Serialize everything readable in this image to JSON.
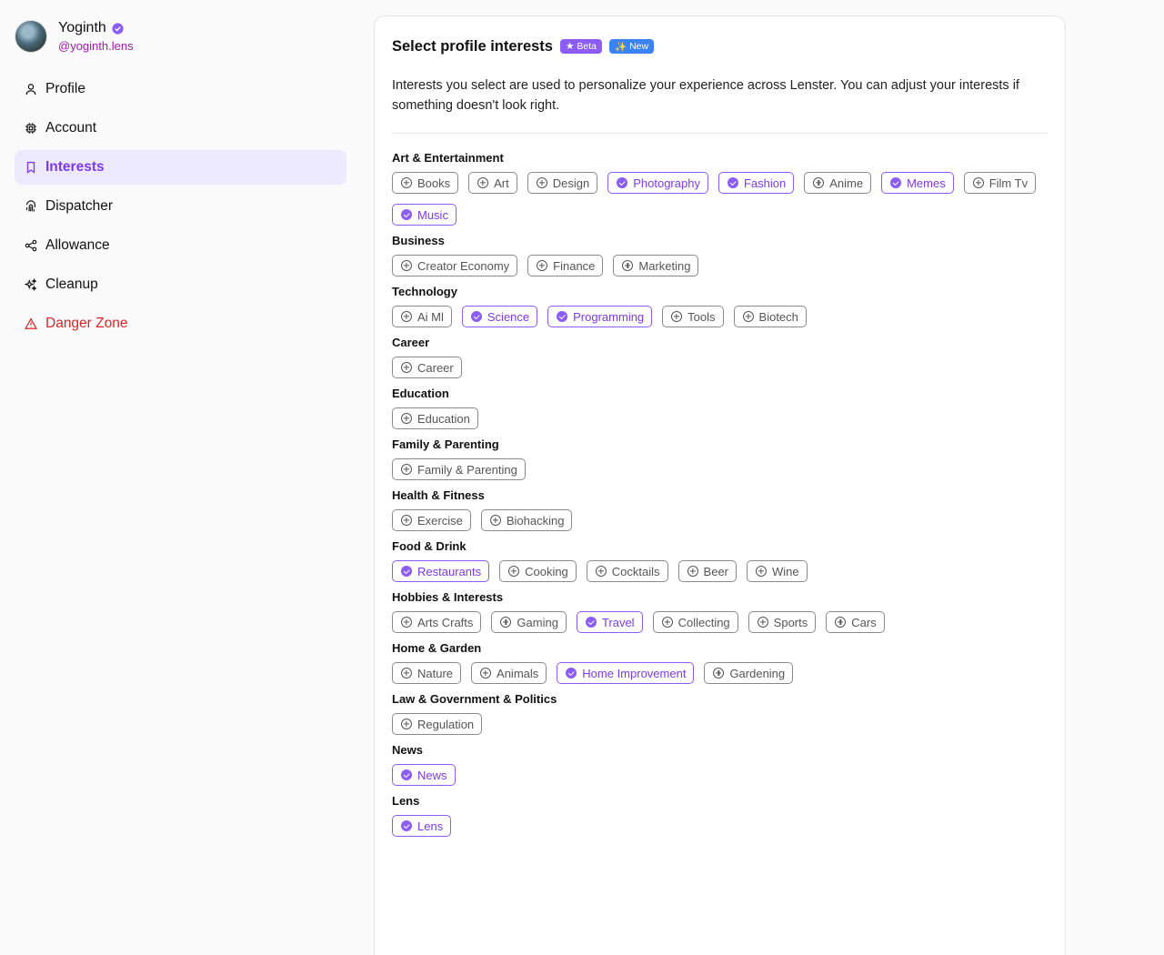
{
  "user": {
    "name": "Yoginth",
    "handle": "@yoginth.lens"
  },
  "nav": [
    {
      "label": "Profile",
      "icon": "user-icon"
    },
    {
      "label": "Account",
      "icon": "chip-icon"
    },
    {
      "label": "Interests",
      "icon": "bookmark-icon",
      "active": true
    },
    {
      "label": "Dispatcher",
      "icon": "fingerprint-icon"
    },
    {
      "label": "Allowance",
      "icon": "share-icon"
    },
    {
      "label": "Cleanup",
      "icon": "sparkles-icon"
    },
    {
      "label": "Danger Zone",
      "icon": "warning-icon",
      "danger": true
    }
  ],
  "card": {
    "title": "Select profile interests",
    "badges": [
      "Beta",
      "New"
    ],
    "description": "Interests you select are used to personalize your experience across Lenster. You can adjust your interests if something doesn't look right."
  },
  "groups": [
    {
      "title": "Art & Entertainment",
      "items": [
        {
          "label": "Books",
          "selected": false
        },
        {
          "label": "Art",
          "selected": false
        },
        {
          "label": "Design",
          "selected": false
        },
        {
          "label": "Photography",
          "selected": true
        },
        {
          "label": "Fashion",
          "selected": true
        },
        {
          "label": "Anime",
          "selected": false
        },
        {
          "label": "Memes",
          "selected": true
        },
        {
          "label": "Film Tv",
          "selected": false
        },
        {
          "label": "Music",
          "selected": true
        }
      ]
    },
    {
      "title": "Business",
      "items": [
        {
          "label": "Creator Economy",
          "selected": false
        },
        {
          "label": "Finance",
          "selected": false
        },
        {
          "label": "Marketing",
          "selected": false
        }
      ]
    },
    {
      "title": "Technology",
      "items": [
        {
          "label": "Ai Ml",
          "selected": false
        },
        {
          "label": "Science",
          "selected": true
        },
        {
          "label": "Programming",
          "selected": true
        },
        {
          "label": "Tools",
          "selected": false
        },
        {
          "label": "Biotech",
          "selected": false
        }
      ]
    },
    {
      "title": "Career",
      "items": [
        {
          "label": "Career",
          "selected": false
        }
      ]
    },
    {
      "title": "Education",
      "items": [
        {
          "label": "Education",
          "selected": false
        }
      ]
    },
    {
      "title": "Family & Parenting",
      "items": [
        {
          "label": "Family & Parenting",
          "selected": false
        }
      ]
    },
    {
      "title": "Health & Fitness",
      "items": [
        {
          "label": "Exercise",
          "selected": false
        },
        {
          "label": "Biohacking",
          "selected": false
        }
      ]
    },
    {
      "title": "Food & Drink",
      "items": [
        {
          "label": "Restaurants",
          "selected": true
        },
        {
          "label": "Cooking",
          "selected": false
        },
        {
          "label": "Cocktails",
          "selected": false
        },
        {
          "label": "Beer",
          "selected": false
        },
        {
          "label": "Wine",
          "selected": false
        }
      ]
    },
    {
      "title": "Hobbies & Interests",
      "items": [
        {
          "label": "Arts Crafts",
          "selected": false
        },
        {
          "label": "Gaming",
          "selected": false
        },
        {
          "label": "Travel",
          "selected": true
        },
        {
          "label": "Collecting",
          "selected": false
        },
        {
          "label": "Sports",
          "selected": false
        },
        {
          "label": "Cars",
          "selected": false
        }
      ]
    },
    {
      "title": "Home & Garden",
      "items": [
        {
          "label": "Nature",
          "selected": false
        },
        {
          "label": "Animals",
          "selected": false
        },
        {
          "label": "Home Improvement",
          "selected": true
        },
        {
          "label": "Gardening",
          "selected": false
        }
      ]
    },
    {
      "title": "Law & Government & Politics",
      "items": [
        {
          "label": "Regulation",
          "selected": false
        }
      ]
    },
    {
      "title": "News",
      "items": [
        {
          "label": "News",
          "selected": true
        }
      ]
    },
    {
      "title": "Lens",
      "items": [
        {
          "label": "Lens",
          "selected": true
        }
      ]
    }
  ],
  "colors": {
    "accent": "#8b5cf6",
    "accent_text": "#7c3aed",
    "handle": "#a21caf",
    "danger": "#dc2626",
    "badge_new": "#3b82f6"
  }
}
